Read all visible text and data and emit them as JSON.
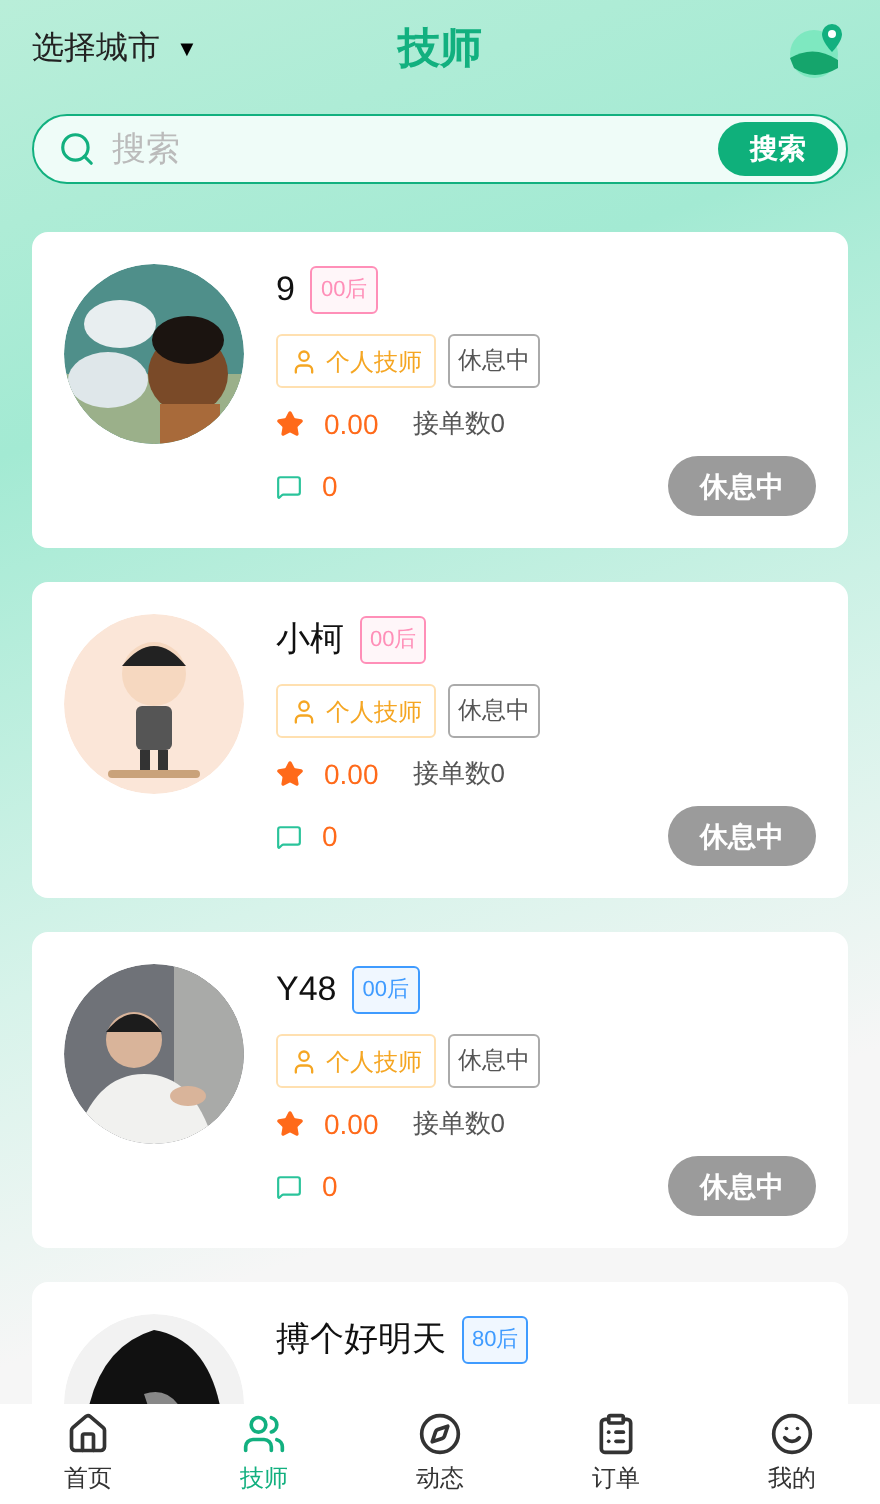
{
  "header": {
    "city": "选择城市",
    "city_caret": "▼",
    "title": "技师"
  },
  "search": {
    "placeholder": "搜索",
    "button": "搜索"
  },
  "technicians": [
    {
      "name": "9",
      "age_tag": {
        "label": "00后",
        "color": "#ff8fb8"
      },
      "type_tag": "个人技师",
      "status_tag": "休息中",
      "rating": "0.00",
      "orders": "接单数0",
      "comments": "0",
      "status_button": "休息中"
    },
    {
      "name": "小柯",
      "age_tag": {
        "label": "00后",
        "color": "#ff8fb8"
      },
      "type_tag": "个人技师",
      "status_tag": "休息中",
      "rating": "0.00",
      "orders": "接单数0",
      "comments": "0",
      "status_button": "休息中"
    },
    {
      "name": "Y48",
      "age_tag": {
        "label": "00后",
        "color": "#3f9bff"
      },
      "type_tag": "个人技师",
      "status_tag": "休息中",
      "rating": "0.00",
      "orders": "接单数0",
      "comments": "0",
      "status_button": "休息中"
    },
    {
      "name": "搏个好明天",
      "age_tag": {
        "label": "80后",
        "color": "#3f9bff"
      }
    }
  ],
  "tab_bar": [
    {
      "label": "首页",
      "selected": false
    },
    {
      "label": "技师",
      "selected": true
    },
    {
      "label": "动态",
      "selected": false
    },
    {
      "label": "订单",
      "selected": false
    },
    {
      "label": "我的",
      "selected": false
    }
  ]
}
